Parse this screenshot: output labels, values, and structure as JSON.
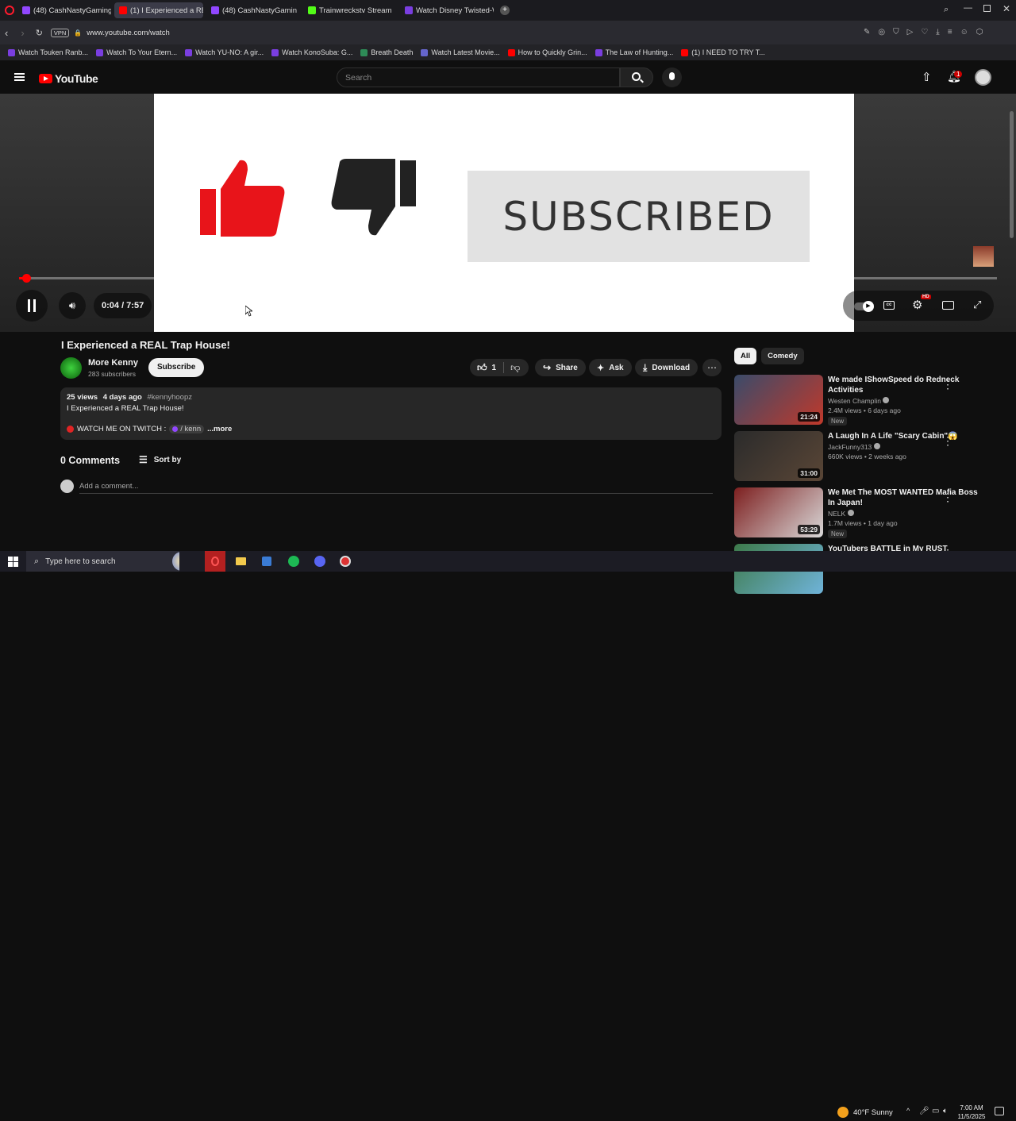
{
  "browser": {
    "tabs": [
      {
        "label": "(48) CashNastyGaming",
        "active": false,
        "color": "#9147ff"
      },
      {
        "label": "(1) I Experienced a RE",
        "active": true,
        "color": "#ff0000"
      },
      {
        "label": "(48) CashNastyGamin",
        "active": false,
        "color": "#9147ff"
      },
      {
        "label": "Trainwreckstv Stream",
        "active": false,
        "color": "#53fc18"
      },
      {
        "label": "Watch Disney Twisted-W",
        "active": false,
        "color": "#7a3ee0"
      }
    ],
    "url": "www.youtube.com/watch",
    "vpn": "VPN",
    "bookmarks": [
      {
        "label": "Watch Touken Ranb...",
        "color": "#7a3ee0"
      },
      {
        "label": "Watch To Your Etern...",
        "color": "#7a3ee0"
      },
      {
        "label": "Watch YU-NO: A gir...",
        "color": "#7a3ee0"
      },
      {
        "label": "Watch KonoSuba: G...",
        "color": "#7a3ee0"
      },
      {
        "label": "Breath Death",
        "color": "#2e8b57"
      },
      {
        "label": "Watch Latest Movie...",
        "color": "#6666cc"
      },
      {
        "label": "How to Quickly Grin...",
        "color": "#ff0000"
      },
      {
        "label": "The Law of Hunting...",
        "color": "#7a3ee0"
      },
      {
        "label": "(1) I NEED TO TRY T...",
        "color": "#ff0000"
      }
    ]
  },
  "youtube": {
    "logo_text": "YouTube",
    "search_placeholder": "Search",
    "notif_count": "1",
    "hd_badge": "HD"
  },
  "player": {
    "thumb_word": "SUBSCRIBED",
    "time": "0:04 / 7:57",
    "progress": 0.008
  },
  "video": {
    "title": "I Experienced a REAL Trap House!",
    "channel": "More Kenny",
    "subscribers": "283 subscribers",
    "subscribe_label": "Subscribe",
    "likes": "1",
    "share_label": "Share",
    "ask_label": "Ask",
    "download_label": "Download"
  },
  "description": {
    "views": "25 views",
    "age": "4 days ago",
    "hashtag": "#kennyhoopz",
    "line1": "I Experienced a REAL Trap House!",
    "twitch_prefix": "WATCH ME ON TWITCH :",
    "twitch_link": "/ kenn",
    "more": "...more"
  },
  "comments": {
    "count_label": "0 Comments",
    "sort_label": "Sort by",
    "add_placeholder": "Add a comment..."
  },
  "chips": [
    "All",
    "Comedy"
  ],
  "recommendations": [
    {
      "title": "We made IShowSpeed do Redneck Activities",
      "channel": "Westen Champlin",
      "meta": "2.4M views • 6 days ago",
      "duration": "21:24",
      "badge": "New",
      "c1": "#3a4b6a",
      "c2": "#c0392b"
    },
    {
      "title": "A Laugh In A Life \"Scary Cabin\"😱",
      "channel": "JackFunny313",
      "meta": "660K views • 2 weeks ago",
      "duration": "31:00",
      "badge": "",
      "c1": "#2b2b2b",
      "c2": "#5a4636"
    },
    {
      "title": "We Met The MOST WANTED Mafia Boss In Japan!",
      "channel": "NELK",
      "meta": "1.7M views • 1 day ago",
      "duration": "53:29",
      "badge": "New",
      "c1": "#7d1f1f",
      "c2": "#d9d9d9"
    },
    {
      "title": "YouTubers BATTLE in My RUST",
      "channel": "",
      "meta": "",
      "duration": "",
      "badge": "",
      "c1": "#3d7a4a",
      "c2": "#6fb3d9"
    }
  ],
  "taskbar": {
    "search_placeholder": "Type here to search",
    "weather": "40°F  Sunny",
    "time": "7:00 AM",
    "date": "11/5/2025"
  }
}
